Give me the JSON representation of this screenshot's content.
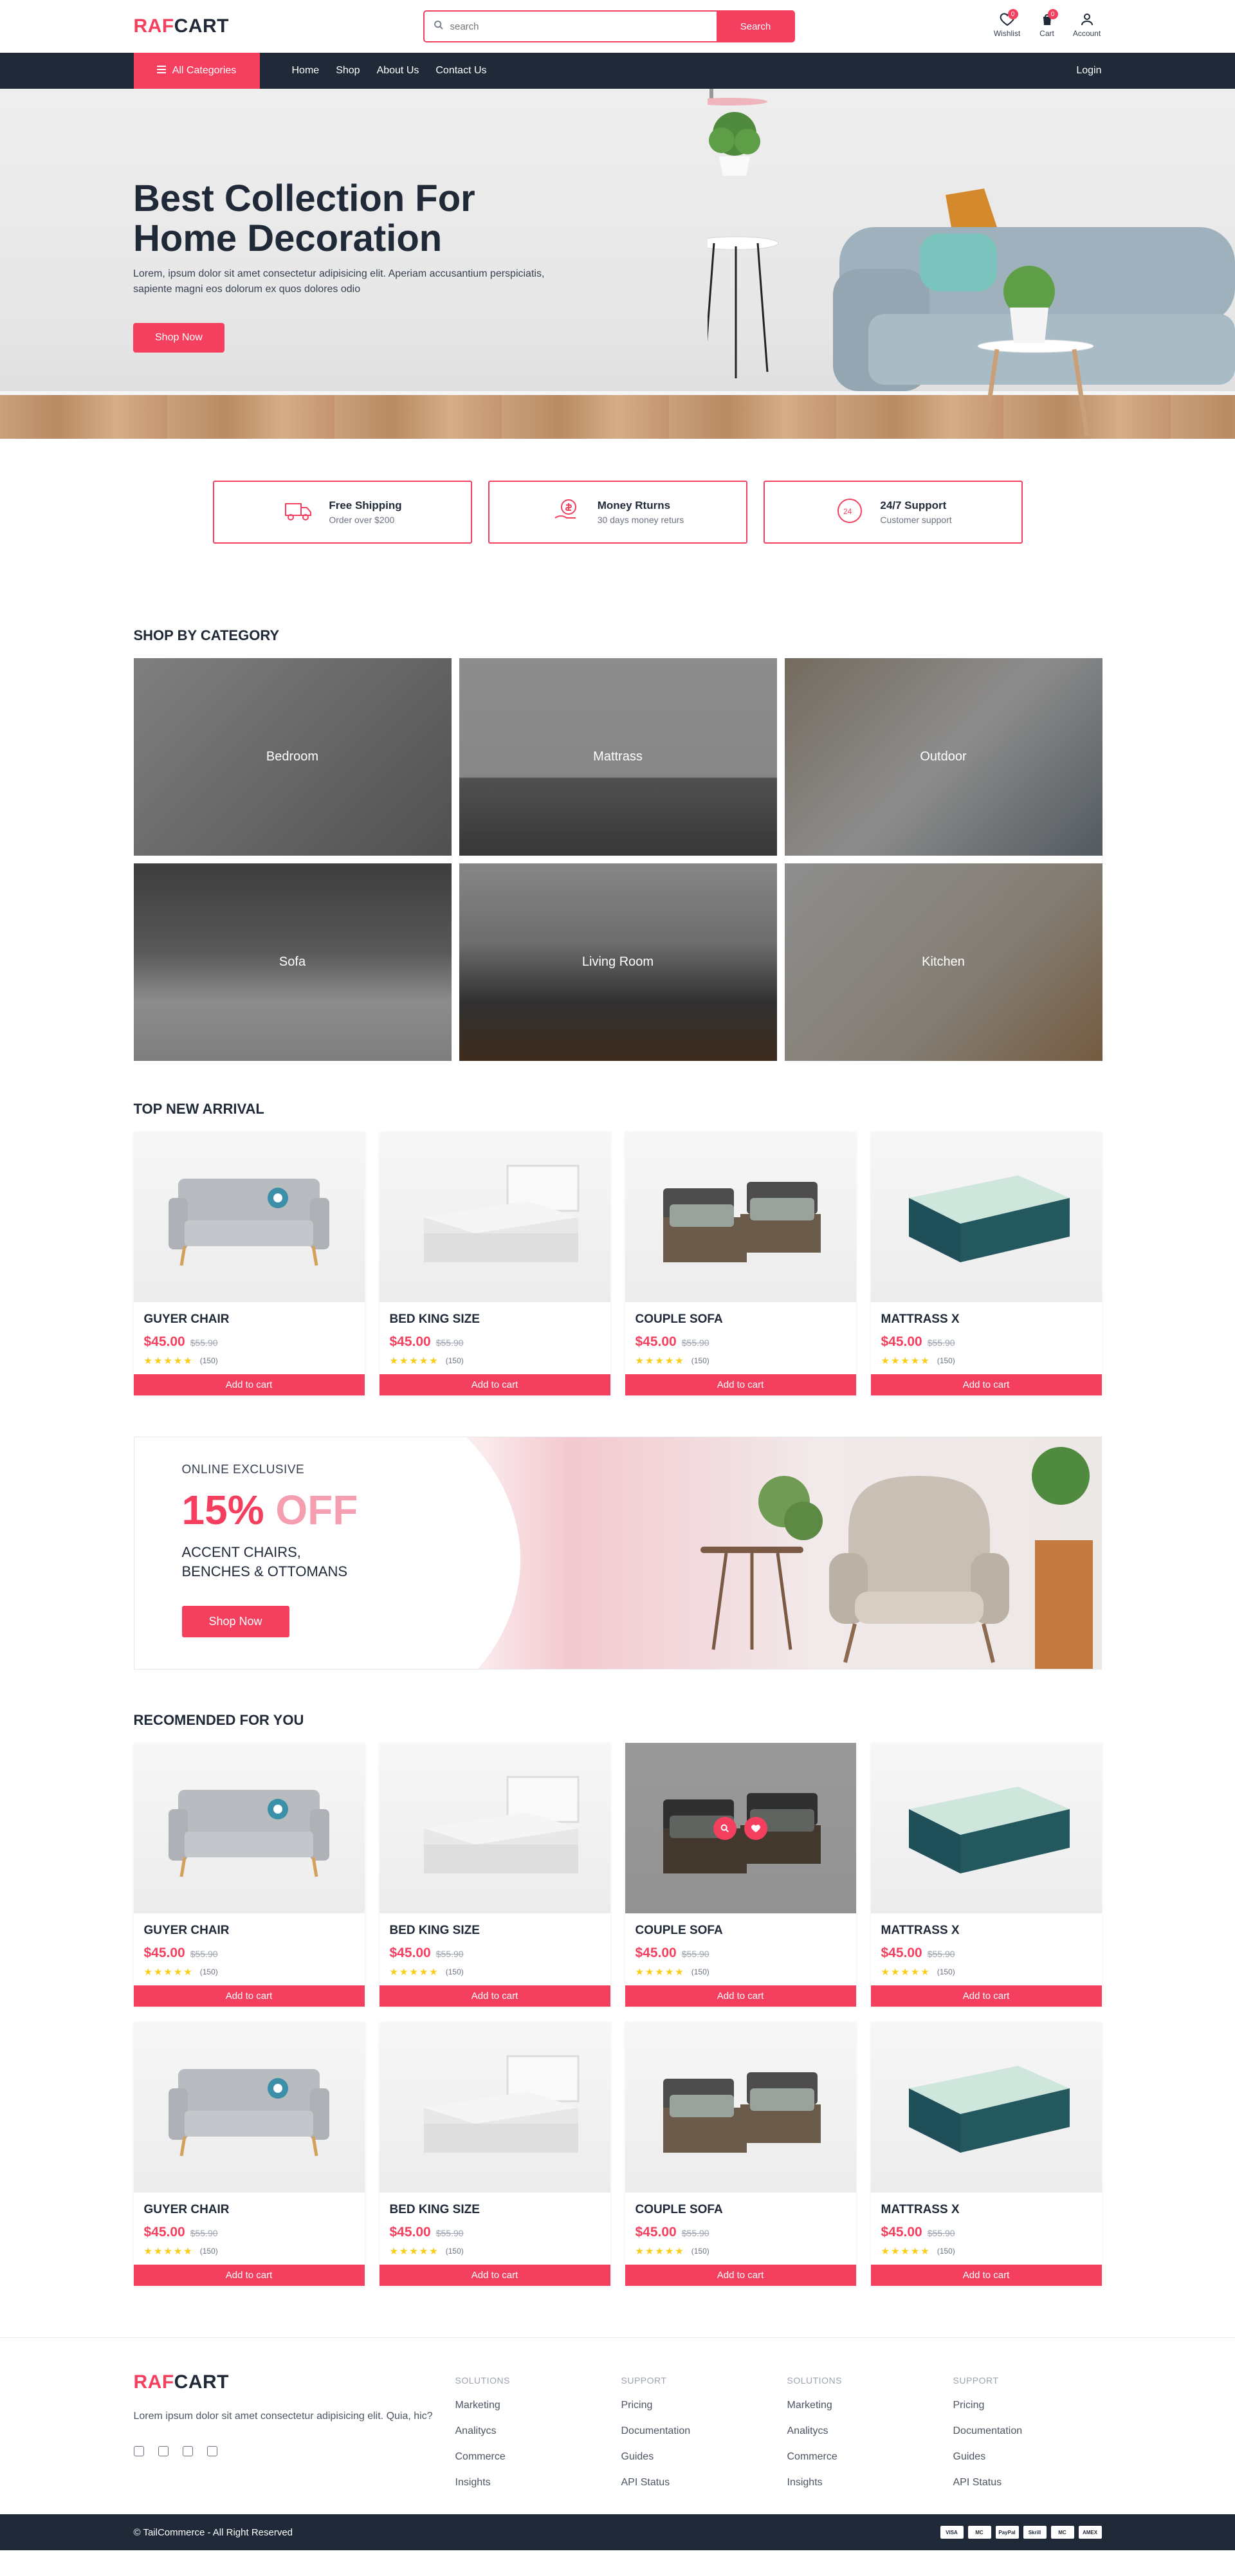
{
  "header": {
    "logo_part1": "RAF",
    "logo_part2": "CART",
    "search_placeholder": "search",
    "search_button": "Search",
    "wishlist_label": "Wishlist",
    "wishlist_count": "0",
    "cart_label": "Cart",
    "cart_count": "0",
    "account_label": "Account"
  },
  "nav": {
    "all_categories": "All Categories",
    "links": [
      "Home",
      "Shop",
      "About Us",
      "Contact Us"
    ],
    "login": "Login"
  },
  "hero": {
    "title": "Best Collection For Home Decoration",
    "text": "Lorem, ipsum dolor sit amet consectetur adipisicing elit. Aperiam accusantium perspiciatis, sapiente magni eos dolorum ex quos dolores odio",
    "button": "Shop Now"
  },
  "features": [
    {
      "title": "Free Shipping",
      "subtitle": "Order over $200",
      "icon": "truck-icon"
    },
    {
      "title": "Money Rturns",
      "subtitle": "30 days money returs",
      "icon": "money-return-icon"
    },
    {
      "title": "24/7 Support",
      "subtitle": "Customer support",
      "icon": "support-icon"
    }
  ],
  "categories": {
    "title": "SHOP BY CATEGORY",
    "items": [
      "Bedroom",
      "Mattrass",
      "Outdoor",
      "Sofa",
      "Living Room",
      "Kitchen"
    ]
  },
  "top_new_arrival": {
    "title": "TOP NEW ARRIVAL",
    "products": [
      {
        "name": "GUYER CHAIR",
        "price": "$45.00",
        "old_price": "$55.90",
        "reviews": "(150)",
        "button": "Add to cart",
        "rating": 5
      },
      {
        "name": "BED KING SIZE",
        "price": "$45.00",
        "old_price": "$55.90",
        "reviews": "(150)",
        "button": "Add to cart",
        "rating": 5
      },
      {
        "name": "COUPLE SOFA",
        "price": "$45.00",
        "old_price": "$55.90",
        "reviews": "(150)",
        "button": "Add to cart",
        "rating": 5
      },
      {
        "name": "MATTRASS X",
        "price": "$45.00",
        "old_price": "$55.90",
        "reviews": "(150)",
        "button": "Add to cart",
        "rating": 5
      }
    ]
  },
  "promo": {
    "kicker": "ONLINE EXCLUSIVE",
    "percent": "15%",
    "off": "OFF",
    "line1": "ACCENT CHAIRS,",
    "line2": "BENCHES & OTTOMANS",
    "button": "Shop Now"
  },
  "recommended": {
    "title": "RECOMENDED FOR YOU",
    "products": [
      {
        "name": "GUYER CHAIR",
        "price": "$45.00",
        "old_price": "$55.90",
        "reviews": "(150)",
        "button": "Add to cart",
        "rating": 5
      },
      {
        "name": "BED KING SIZE",
        "price": "$45.00",
        "old_price": "$55.90",
        "reviews": "(150)",
        "button": "Add to cart",
        "rating": 5
      },
      {
        "name": "COUPLE SOFA",
        "price": "$45.00",
        "old_price": "$55.90",
        "reviews": "(150)",
        "button": "Add to cart",
        "rating": 5
      },
      {
        "name": "MATTRASS X",
        "price": "$45.00",
        "old_price": "$55.90",
        "reviews": "(150)",
        "button": "Add to cart",
        "rating": 5
      },
      {
        "name": "GUYER CHAIR",
        "price": "$45.00",
        "old_price": "$55.90",
        "reviews": "(150)",
        "button": "Add to cart",
        "rating": 5
      },
      {
        "name": "BED KING SIZE",
        "price": "$45.00",
        "old_price": "$55.90",
        "reviews": "(150)",
        "button": "Add to cart",
        "rating": 5
      },
      {
        "name": "COUPLE SOFA",
        "price": "$45.00",
        "old_price": "$55.90",
        "reviews": "(150)",
        "button": "Add to cart",
        "rating": 5
      },
      {
        "name": "MATTRASS X",
        "price": "$45.00",
        "old_price": "$55.90",
        "reviews": "(150)",
        "button": "Add to cart",
        "rating": 5
      }
    ]
  },
  "footer": {
    "logo_part1": "RAF",
    "logo_part2": "CART",
    "text": "Lorem ipsum dolor sit amet consectetur adipisicing elit. Quia, hic?",
    "columns": [
      {
        "heading": "SOLUTIONS",
        "links": [
          "Marketing",
          "Analitycs",
          "Commerce",
          "Insights"
        ]
      },
      {
        "heading": "SUPPORT",
        "links": [
          "Pricing",
          "Documentation",
          "Guides",
          "API Status"
        ]
      },
      {
        "heading": "SOLUTIONS",
        "links": [
          "Marketing",
          "Analitycs",
          "Commerce",
          "Insights"
        ]
      },
      {
        "heading": "SUPPORT",
        "links": [
          "Pricing",
          "Documentation",
          "Guides",
          "API Status"
        ]
      }
    ],
    "copyright": "© TailCommerce - All Right Reserved",
    "payment_methods": [
      "VISA",
      "MC",
      "PayPal",
      "Skrill",
      "MC",
      "AMEX"
    ]
  },
  "colors": {
    "accent": "#f43f5e",
    "dark": "#1f2937"
  }
}
